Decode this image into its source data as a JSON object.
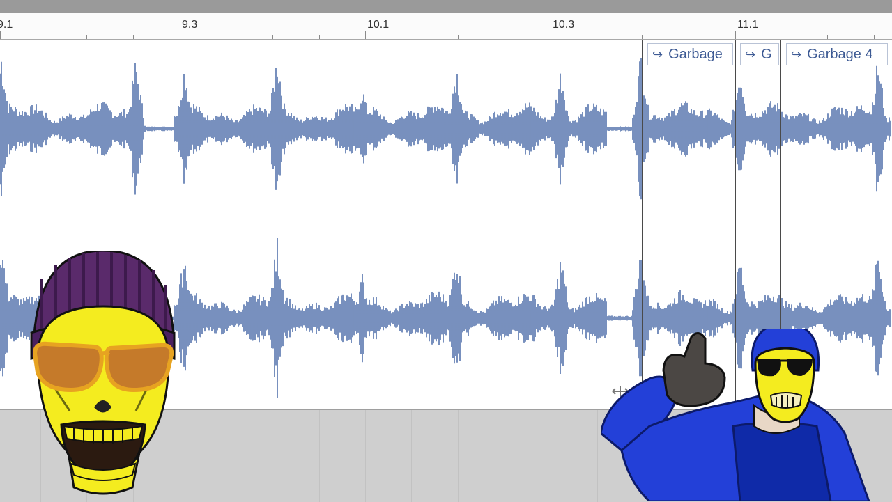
{
  "ruler": {
    "labels": [
      "9.1",
      "9.3",
      "10.1",
      "10.3",
      "11.1"
    ]
  },
  "markers": [
    {
      "label": "Garbage"
    },
    {
      "label": "G"
    },
    {
      "label": "Garbage 4"
    }
  ],
  "colors": {
    "waveform": "#5674ad",
    "track_bg": "#ffffff",
    "lower_bg": "#cfcfcf",
    "marker_text": "#3d5a94"
  },
  "icons": {
    "marker_arrow": "split-arrow-icon",
    "move_handle": "move-cursor-icon"
  },
  "overlays": [
    "skull-beanie-sunglasses-illustration",
    "thumbs-up-blue-suit-skull-illustration"
  ]
}
